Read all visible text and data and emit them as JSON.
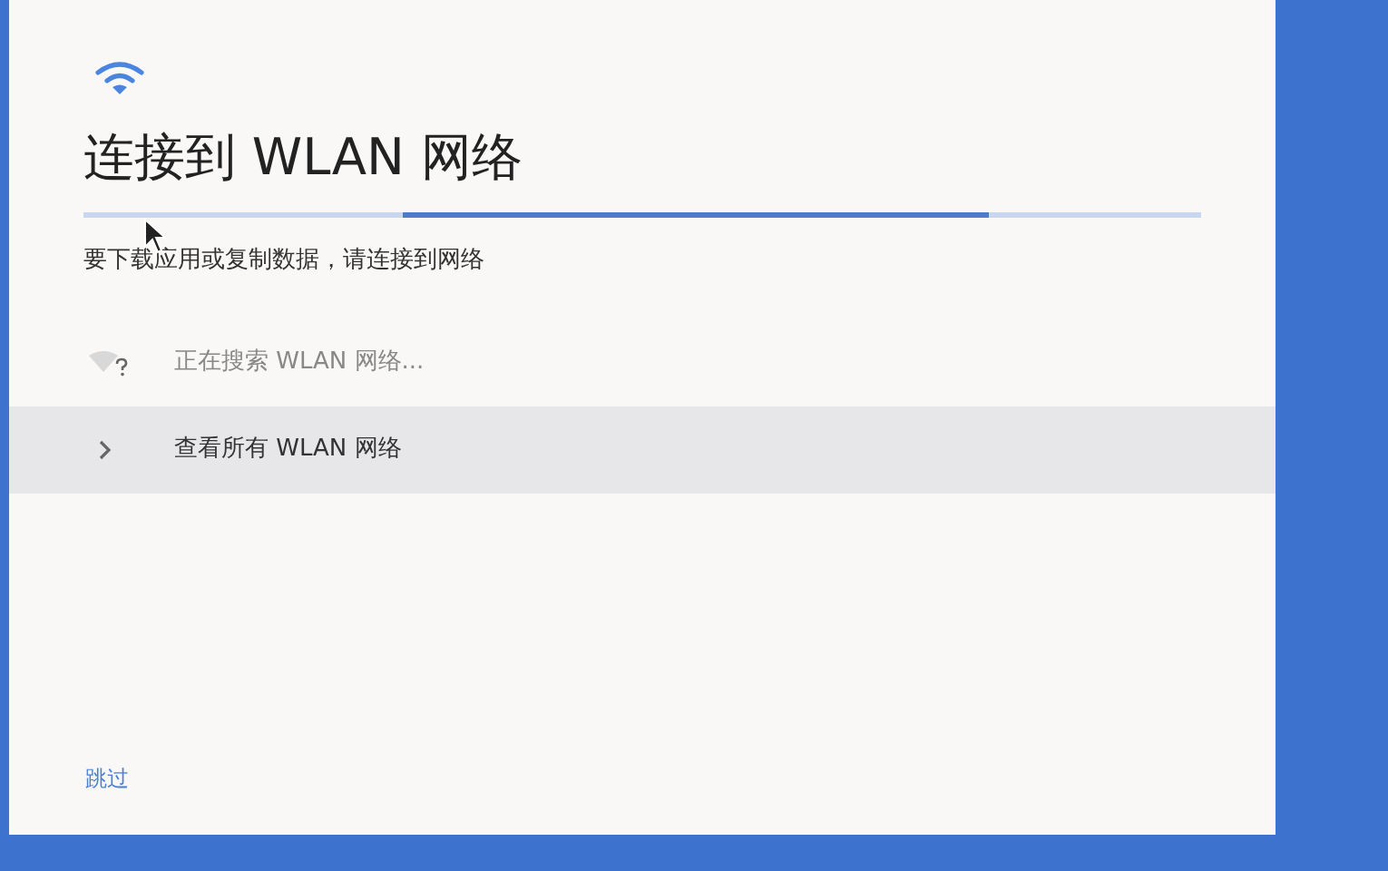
{
  "title": "连接到 WLAN 网络",
  "progress": {
    "kind": "indeterminate"
  },
  "subtitle": "要下载应用或复制数据，请连接到网络",
  "items": [
    {
      "kind": "searching",
      "label": "正在搜索 WLAN 网络...",
      "selected": false
    },
    {
      "kind": "link",
      "label": "查看所有 WLAN 网络",
      "selected": true
    }
  ],
  "skip_button": "跳过"
}
